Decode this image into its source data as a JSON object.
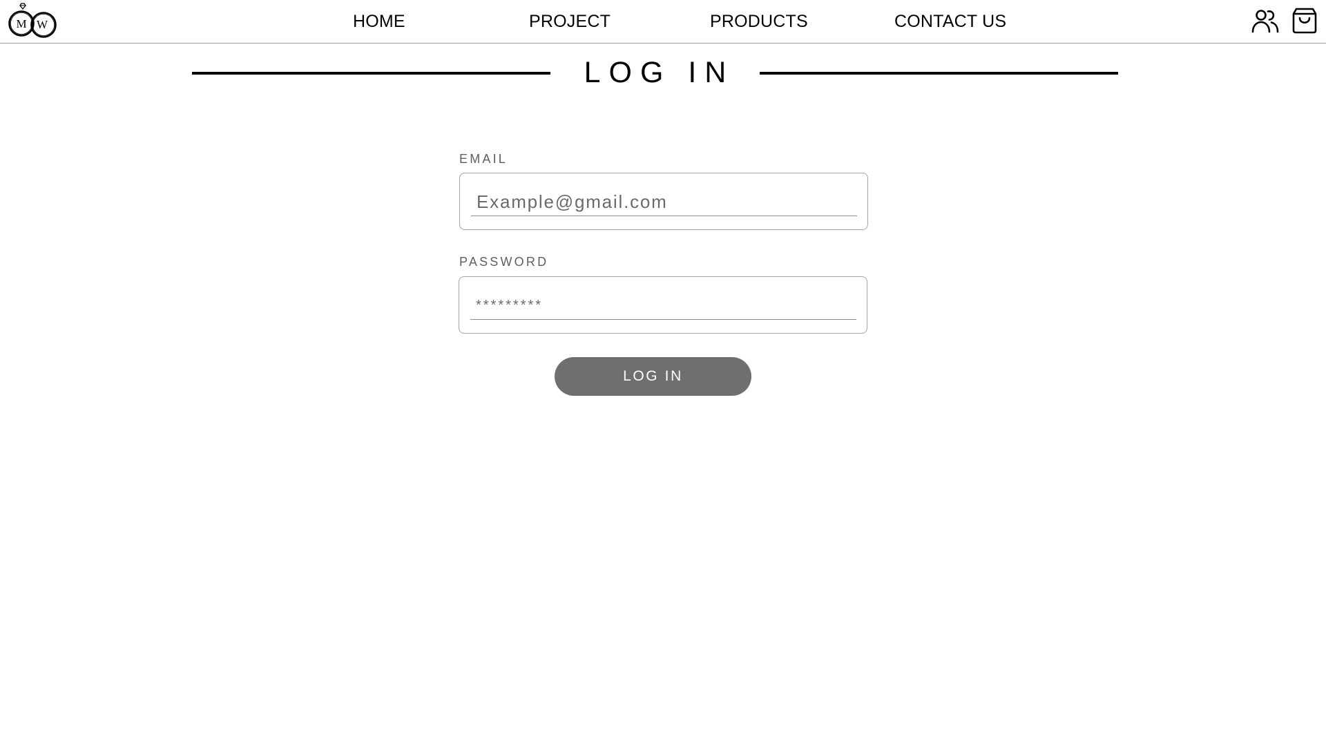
{
  "brand": {
    "logo_letters": [
      "M",
      "W"
    ]
  },
  "nav": {
    "items": [
      {
        "label": "HOME"
      },
      {
        "label": "PROJECT"
      },
      {
        "label": "PRODUCTS"
      },
      {
        "label": "CONTACT US"
      }
    ]
  },
  "header_icons": {
    "account": "users-icon",
    "cart": "shopping-bag-icon"
  },
  "page": {
    "title": "LOG IN"
  },
  "form": {
    "email": {
      "label": "EMAIL",
      "value": "",
      "placeholder": "Example@gmail.com"
    },
    "password": {
      "label": "PASSWORD",
      "value": "",
      "placeholder": "*********"
    },
    "submit_label": "LOG IN"
  },
  "colors": {
    "button_background": "#6f6f6f",
    "button_text": "#ffffff",
    "label_text": "#5f5f5f",
    "field_border": "#a3a3a3",
    "title_rule": "#000000"
  }
}
